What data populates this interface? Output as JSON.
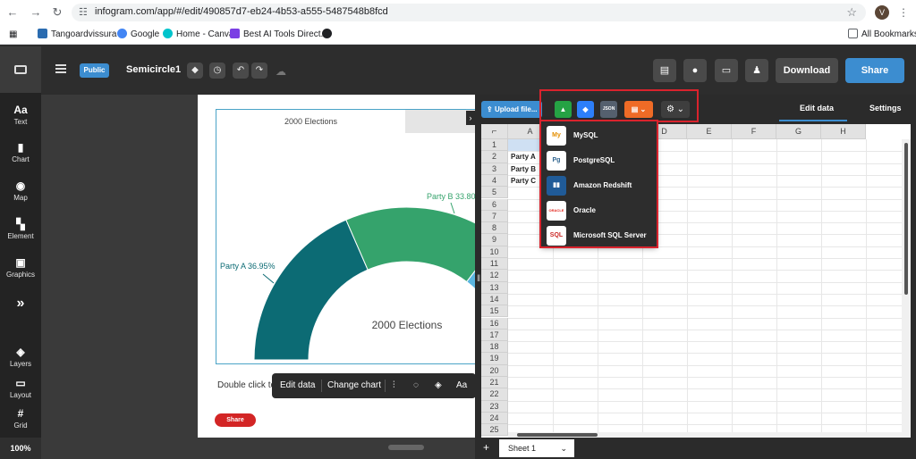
{
  "browser": {
    "url": "infogram.com/app/#/edit/490857d7-eb24-4b53-a555-5487548b8fcd",
    "profile_initial": "V",
    "bookmarks": [
      {
        "label": "Tangoardvissura -",
        "color": "#2b6cb0"
      },
      {
        "label": "Google",
        "color": "#4285f4"
      },
      {
        "label": "Home - Canva",
        "color": "#00c4cc"
      },
      {
        "label": "Best AI Tools Direct...",
        "color": "#7b3fe4"
      },
      {
        "label": "",
        "color": "#202124"
      }
    ],
    "all_bookmarks": "All Bookmarks"
  },
  "sidebar": {
    "items": [
      {
        "icon": "Aa",
        "label": "Text"
      },
      {
        "icon": "▮",
        "label": "Chart"
      },
      {
        "icon": "◉",
        "label": "Map"
      },
      {
        "icon": "▚",
        "label": "Element"
      },
      {
        "icon": "▣",
        "label": "Graphics"
      },
      {
        "icon": "»",
        "label": ""
      },
      {
        "icon": "◈",
        "label": "Layers"
      },
      {
        "icon": "▭",
        "label": "Layout"
      },
      {
        "icon": "#",
        "label": "Grid"
      }
    ],
    "zoom": "100%"
  },
  "topbar": {
    "public_label": "Public",
    "title": "Semicircle1",
    "download": "Download",
    "share": "Share"
  },
  "canvas": {
    "tab_active": "2000 Elections",
    "chart_center_label": "2000 Elections",
    "double_click_text": "Double click to",
    "share_small": "Share",
    "toolbar": {
      "edit_data": "Edit data",
      "change_chart": "Change chart",
      "aa": "Aa"
    }
  },
  "chart_data": {
    "type": "pie",
    "subtype": "semicircle",
    "title": "2000 Elections",
    "slices": [
      {
        "label": "Party A",
        "value": 36.95,
        "display": "Party A 36.95%",
        "color": "#0c6b74"
      },
      {
        "label": "Party B",
        "value": 33.8,
        "display": "Party B 33.80%",
        "color": "#35a36c"
      },
      {
        "label": "Party C",
        "value": 29.25,
        "display": "",
        "color": "#5bb6e0"
      }
    ]
  },
  "panel": {
    "upload": "Upload file...",
    "json": "JSON",
    "tab_edit": "Edit data",
    "tab_settings": "Settings",
    "columns": [
      "A",
      "B",
      "C",
      "D",
      "E",
      "F",
      "G",
      "H"
    ],
    "rows": [
      "1",
      "2",
      "3",
      "4",
      "5",
      "6",
      "7",
      "8",
      "9",
      "10",
      "11",
      "12",
      "13",
      "14",
      "15",
      "16",
      "17",
      "18",
      "19",
      "20",
      "21",
      "22",
      "23",
      "24",
      "25"
    ],
    "cells": [
      {
        "row": 2,
        "text": "Party A"
      },
      {
        "row": 3,
        "text": "Party B"
      },
      {
        "row": 4,
        "text": "Party C"
      }
    ],
    "sheet": "Sheet 1",
    "add_sheet": "+"
  },
  "dropdown": {
    "items": [
      {
        "label": "MySQL",
        "icon_text": "My",
        "color": "#e48e00"
      },
      {
        "label": "PostgreSQL",
        "icon_text": "Pg",
        "color": "#336791"
      },
      {
        "label": "Amazon Redshift",
        "icon_text": "▮▮",
        "color": "#205b98"
      },
      {
        "label": "Oracle",
        "icon_text": "ORACLE",
        "color": "#e2231a"
      },
      {
        "label": "Microsoft SQL Server",
        "icon_text": "SQL",
        "color": "#cc2927"
      }
    ]
  }
}
